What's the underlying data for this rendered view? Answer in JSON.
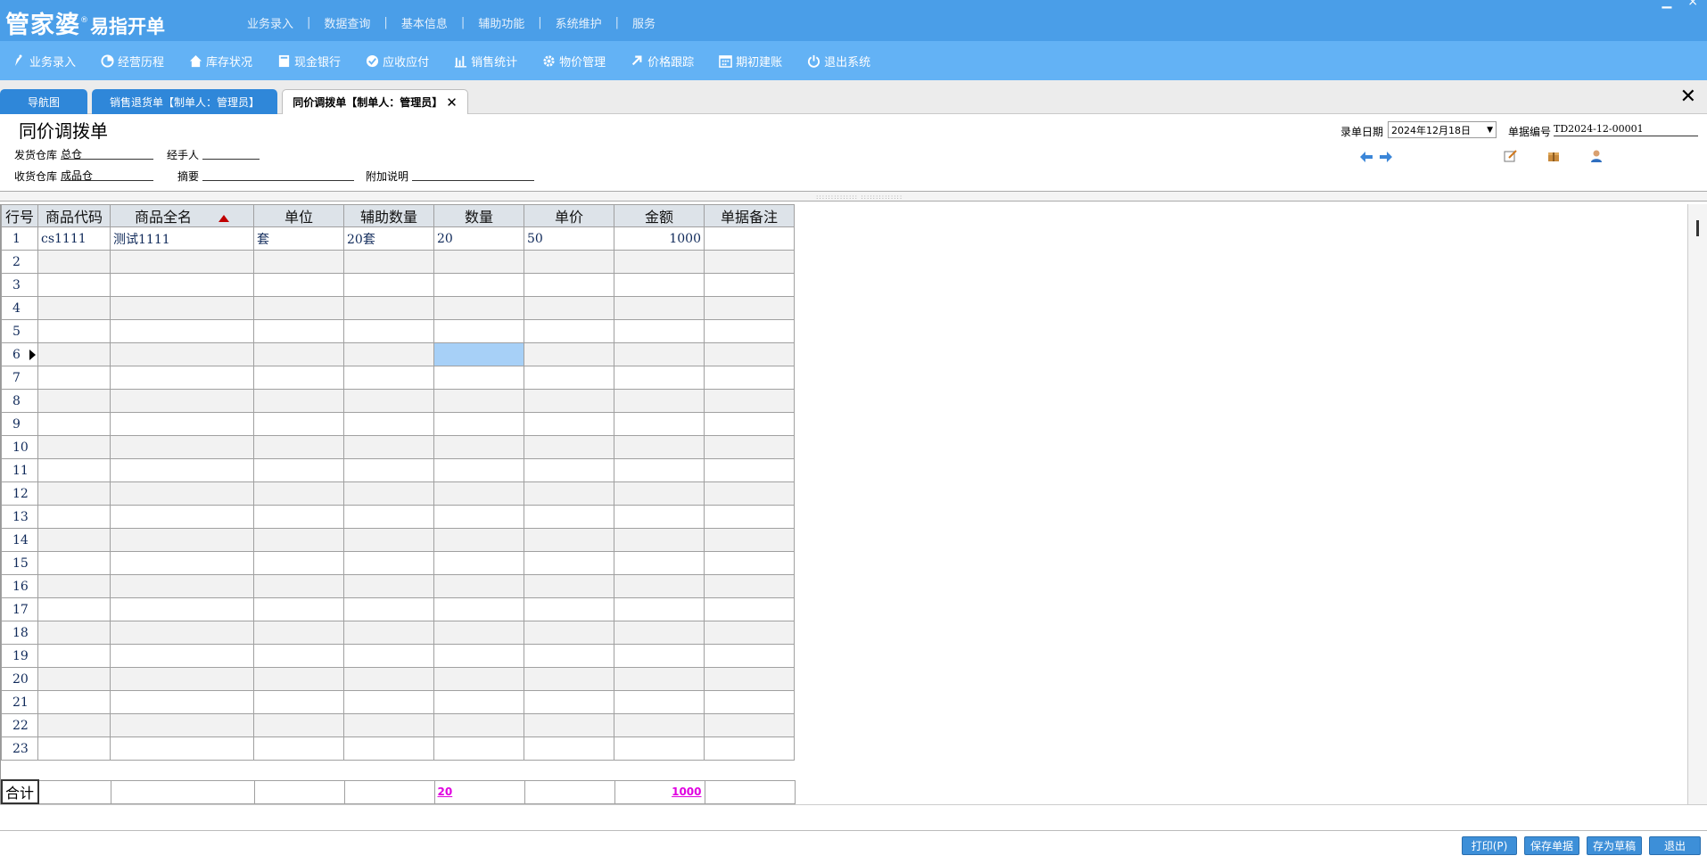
{
  "app": {
    "logo_main": "管家婆",
    "logo_sub": "易指开单",
    "logo_reg": "®"
  },
  "top_menu": [
    "业务录入",
    "数据查询",
    "基本信息",
    "辅助功能",
    "系统维护",
    "服务"
  ],
  "top_menu_separator": "|",
  "toolbar": [
    {
      "label": "业务录入",
      "icon": "pen-icon"
    },
    {
      "label": "经营历程",
      "icon": "pie-chart-icon"
    },
    {
      "label": "库存状况",
      "icon": "home-icon"
    },
    {
      "label": "现金银行",
      "icon": "book-icon"
    },
    {
      "label": "应收应付",
      "icon": "check-circle-icon"
    },
    {
      "label": "销售统计",
      "icon": "bar-chart-icon"
    },
    {
      "label": "物价管理",
      "icon": "gear-icon"
    },
    {
      "label": "价格跟踪",
      "icon": "arrow-up-right-icon"
    },
    {
      "label": "期初建账",
      "icon": "calendar-icon"
    },
    {
      "label": "退出系统",
      "icon": "power-icon"
    }
  ],
  "tabs": [
    {
      "label": "导航图"
    },
    {
      "label": "销售退货单【制单人：管理员】"
    },
    {
      "label": "同价调拨单【制单人：管理员】"
    }
  ],
  "form": {
    "title": "同价调拨单",
    "out_warehouse_label": "发货仓库",
    "out_warehouse_value": "总仓",
    "handler_label": "经手人",
    "handler_value": "",
    "in_warehouse_label": "收货仓库",
    "in_warehouse_value": "成品仓",
    "summary_label": "摘要",
    "summary_value": "",
    "note_label": "附加说明",
    "note_value": "",
    "date_label": "录单日期",
    "date_value": "2024年12月18日",
    "bill_no_label": "单据编号",
    "bill_no_value": "TD2024-12-00001"
  },
  "grid": {
    "columns": [
      "行号",
      "商品代码",
      "商品全名",
      "单位",
      "辅助数量",
      "数量",
      "单价",
      "金额",
      "单据备注"
    ],
    "rows": [
      {
        "no": "1",
        "code": "cs1111",
        "name": "测试1111",
        "unit": "套",
        "aux_qty": "20套",
        "qty": "20",
        "price": "50",
        "amount": "1000",
        "remark": ""
      },
      {
        "no": "2"
      },
      {
        "no": "3"
      },
      {
        "no": "4"
      },
      {
        "no": "5"
      },
      {
        "no": "6"
      },
      {
        "no": "7"
      },
      {
        "no": "8"
      },
      {
        "no": "9"
      },
      {
        "no": "10"
      },
      {
        "no": "11"
      },
      {
        "no": "12"
      },
      {
        "no": "13"
      },
      {
        "no": "14"
      },
      {
        "no": "15"
      },
      {
        "no": "16"
      },
      {
        "no": "17"
      },
      {
        "no": "18"
      },
      {
        "no": "19"
      },
      {
        "no": "20"
      },
      {
        "no": "21"
      },
      {
        "no": "22"
      },
      {
        "no": "23"
      }
    ],
    "current_row": "6",
    "selected_column": "数量",
    "sorted_column": "商品全名",
    "total_label": "合计",
    "total_qty": "20",
    "total_amount": "1000"
  },
  "buttons": {
    "print": "打印(P)",
    "save": "保存单据",
    "draft": "存为草稿",
    "exit": "退出"
  },
  "colors": {
    "header": "#4a9ee8",
    "toolbar": "#63b2f5",
    "tab_blue": "#2f87d9",
    "selected_cell": "#a7d0f7",
    "total_highlight": "#e000e0",
    "button": "#3d8fd8"
  }
}
